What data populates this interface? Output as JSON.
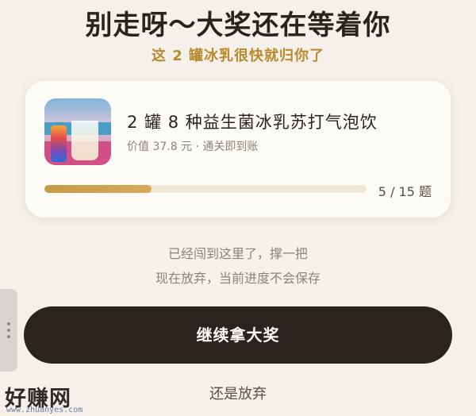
{
  "header": {
    "title": "别走呀～大奖还在等着你",
    "subtitle": "这 2 罐冰乳很快就归你了"
  },
  "prize_card": {
    "image_icon": "product-photo",
    "product_name": "2 罐 8 种益生菌冰乳苏打气泡饮",
    "product_meta": "价值 37.8 元 · 通关即到账",
    "progress_fraction": 0.3333,
    "progress_label": "5 / 15 题"
  },
  "hints": {
    "line1": "已经闯到这里了，撑一把",
    "line2": "现在放弃，当前进度不会保存"
  },
  "actions": {
    "continue_label": "继续拿大奖",
    "quit_label": "还是放弃"
  },
  "watermark": {
    "brand": "好赚网",
    "url": "www.zhuanyes.com"
  },
  "colors": {
    "accent": "#b98a2b",
    "primary_button": "#2b241e",
    "progress_fill": "#c99a45"
  }
}
